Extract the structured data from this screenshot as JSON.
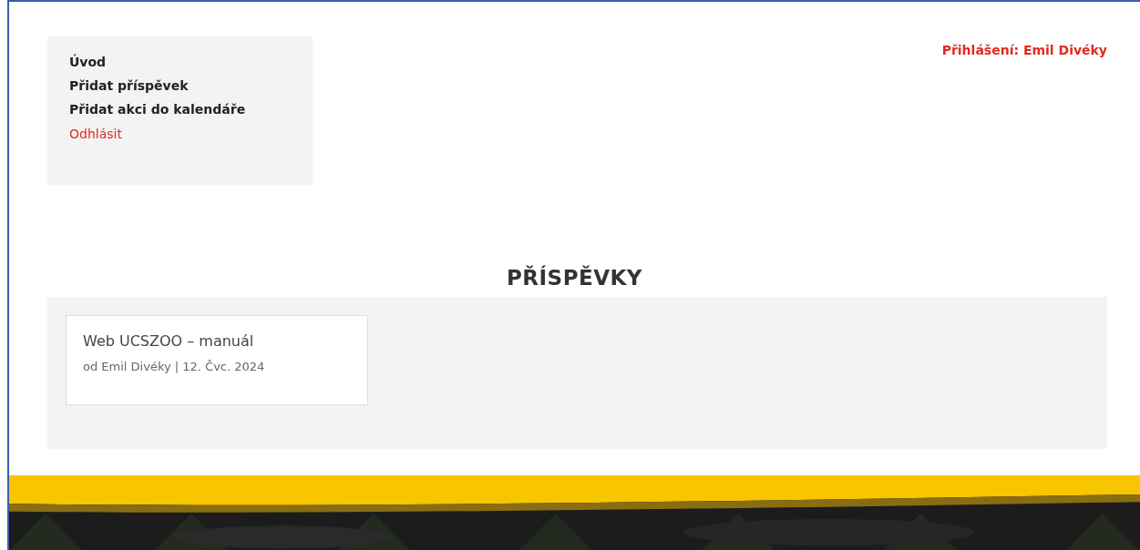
{
  "menu": {
    "items": [
      {
        "label": "Úvod",
        "kind": "link"
      },
      {
        "label": "Přidat příspěvek",
        "kind": "link"
      },
      {
        "label": "Přidat akci do kalendáře",
        "kind": "link"
      },
      {
        "label": "Odhlásit",
        "kind": "logout"
      }
    ]
  },
  "login_status": "Přihlášení: Emil Divéky",
  "heading": "PŘÍSPĚVKY",
  "posts": [
    {
      "title": "Web UCSZOO – manuál",
      "meta": "od Emil Divéky | 12. Čvc. 2024"
    }
  ]
}
